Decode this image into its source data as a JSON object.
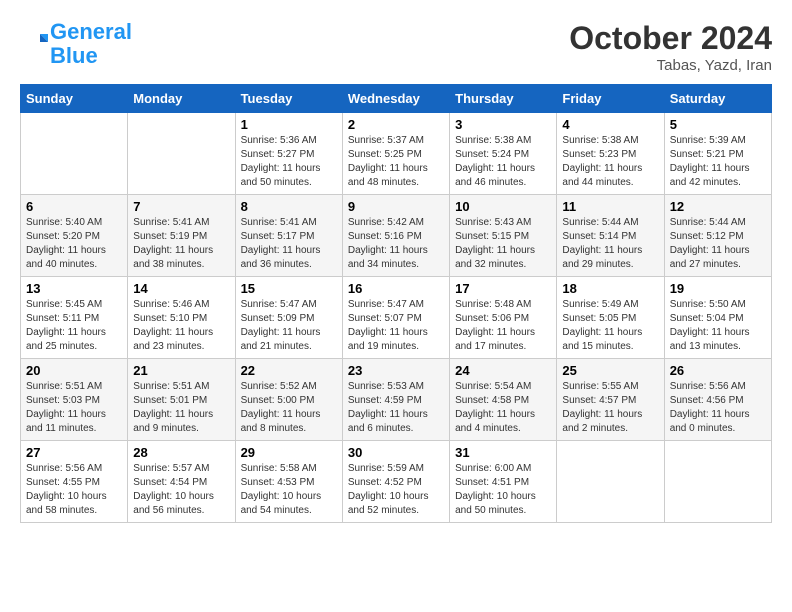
{
  "logo": {
    "line1": "General",
    "line2": "Blue"
  },
  "title": "October 2024",
  "location": "Tabas, Yazd, Iran",
  "days_of_week": [
    "Sunday",
    "Monday",
    "Tuesday",
    "Wednesday",
    "Thursday",
    "Friday",
    "Saturday"
  ],
  "weeks": [
    [
      {
        "num": "",
        "info": ""
      },
      {
        "num": "",
        "info": ""
      },
      {
        "num": "1",
        "info": "Sunrise: 5:36 AM\nSunset: 5:27 PM\nDaylight: 11 hours and 50 minutes."
      },
      {
        "num": "2",
        "info": "Sunrise: 5:37 AM\nSunset: 5:25 PM\nDaylight: 11 hours and 48 minutes."
      },
      {
        "num": "3",
        "info": "Sunrise: 5:38 AM\nSunset: 5:24 PM\nDaylight: 11 hours and 46 minutes."
      },
      {
        "num": "4",
        "info": "Sunrise: 5:38 AM\nSunset: 5:23 PM\nDaylight: 11 hours and 44 minutes."
      },
      {
        "num": "5",
        "info": "Sunrise: 5:39 AM\nSunset: 5:21 PM\nDaylight: 11 hours and 42 minutes."
      }
    ],
    [
      {
        "num": "6",
        "info": "Sunrise: 5:40 AM\nSunset: 5:20 PM\nDaylight: 11 hours and 40 minutes."
      },
      {
        "num": "7",
        "info": "Sunrise: 5:41 AM\nSunset: 5:19 PM\nDaylight: 11 hours and 38 minutes."
      },
      {
        "num": "8",
        "info": "Sunrise: 5:41 AM\nSunset: 5:17 PM\nDaylight: 11 hours and 36 minutes."
      },
      {
        "num": "9",
        "info": "Sunrise: 5:42 AM\nSunset: 5:16 PM\nDaylight: 11 hours and 34 minutes."
      },
      {
        "num": "10",
        "info": "Sunrise: 5:43 AM\nSunset: 5:15 PM\nDaylight: 11 hours and 32 minutes."
      },
      {
        "num": "11",
        "info": "Sunrise: 5:44 AM\nSunset: 5:14 PM\nDaylight: 11 hours and 29 minutes."
      },
      {
        "num": "12",
        "info": "Sunrise: 5:44 AM\nSunset: 5:12 PM\nDaylight: 11 hours and 27 minutes."
      }
    ],
    [
      {
        "num": "13",
        "info": "Sunrise: 5:45 AM\nSunset: 5:11 PM\nDaylight: 11 hours and 25 minutes."
      },
      {
        "num": "14",
        "info": "Sunrise: 5:46 AM\nSunset: 5:10 PM\nDaylight: 11 hours and 23 minutes."
      },
      {
        "num": "15",
        "info": "Sunrise: 5:47 AM\nSunset: 5:09 PM\nDaylight: 11 hours and 21 minutes."
      },
      {
        "num": "16",
        "info": "Sunrise: 5:47 AM\nSunset: 5:07 PM\nDaylight: 11 hours and 19 minutes."
      },
      {
        "num": "17",
        "info": "Sunrise: 5:48 AM\nSunset: 5:06 PM\nDaylight: 11 hours and 17 minutes."
      },
      {
        "num": "18",
        "info": "Sunrise: 5:49 AM\nSunset: 5:05 PM\nDaylight: 11 hours and 15 minutes."
      },
      {
        "num": "19",
        "info": "Sunrise: 5:50 AM\nSunset: 5:04 PM\nDaylight: 11 hours and 13 minutes."
      }
    ],
    [
      {
        "num": "20",
        "info": "Sunrise: 5:51 AM\nSunset: 5:03 PM\nDaylight: 11 hours and 11 minutes."
      },
      {
        "num": "21",
        "info": "Sunrise: 5:51 AM\nSunset: 5:01 PM\nDaylight: 11 hours and 9 minutes."
      },
      {
        "num": "22",
        "info": "Sunrise: 5:52 AM\nSunset: 5:00 PM\nDaylight: 11 hours and 8 minutes."
      },
      {
        "num": "23",
        "info": "Sunrise: 5:53 AM\nSunset: 4:59 PM\nDaylight: 11 hours and 6 minutes."
      },
      {
        "num": "24",
        "info": "Sunrise: 5:54 AM\nSunset: 4:58 PM\nDaylight: 11 hours and 4 minutes."
      },
      {
        "num": "25",
        "info": "Sunrise: 5:55 AM\nSunset: 4:57 PM\nDaylight: 11 hours and 2 minutes."
      },
      {
        "num": "26",
        "info": "Sunrise: 5:56 AM\nSunset: 4:56 PM\nDaylight: 11 hours and 0 minutes."
      }
    ],
    [
      {
        "num": "27",
        "info": "Sunrise: 5:56 AM\nSunset: 4:55 PM\nDaylight: 10 hours and 58 minutes."
      },
      {
        "num": "28",
        "info": "Sunrise: 5:57 AM\nSunset: 4:54 PM\nDaylight: 10 hours and 56 minutes."
      },
      {
        "num": "29",
        "info": "Sunrise: 5:58 AM\nSunset: 4:53 PM\nDaylight: 10 hours and 54 minutes."
      },
      {
        "num": "30",
        "info": "Sunrise: 5:59 AM\nSunset: 4:52 PM\nDaylight: 10 hours and 52 minutes."
      },
      {
        "num": "31",
        "info": "Sunrise: 6:00 AM\nSunset: 4:51 PM\nDaylight: 10 hours and 50 minutes."
      },
      {
        "num": "",
        "info": ""
      },
      {
        "num": "",
        "info": ""
      }
    ]
  ]
}
